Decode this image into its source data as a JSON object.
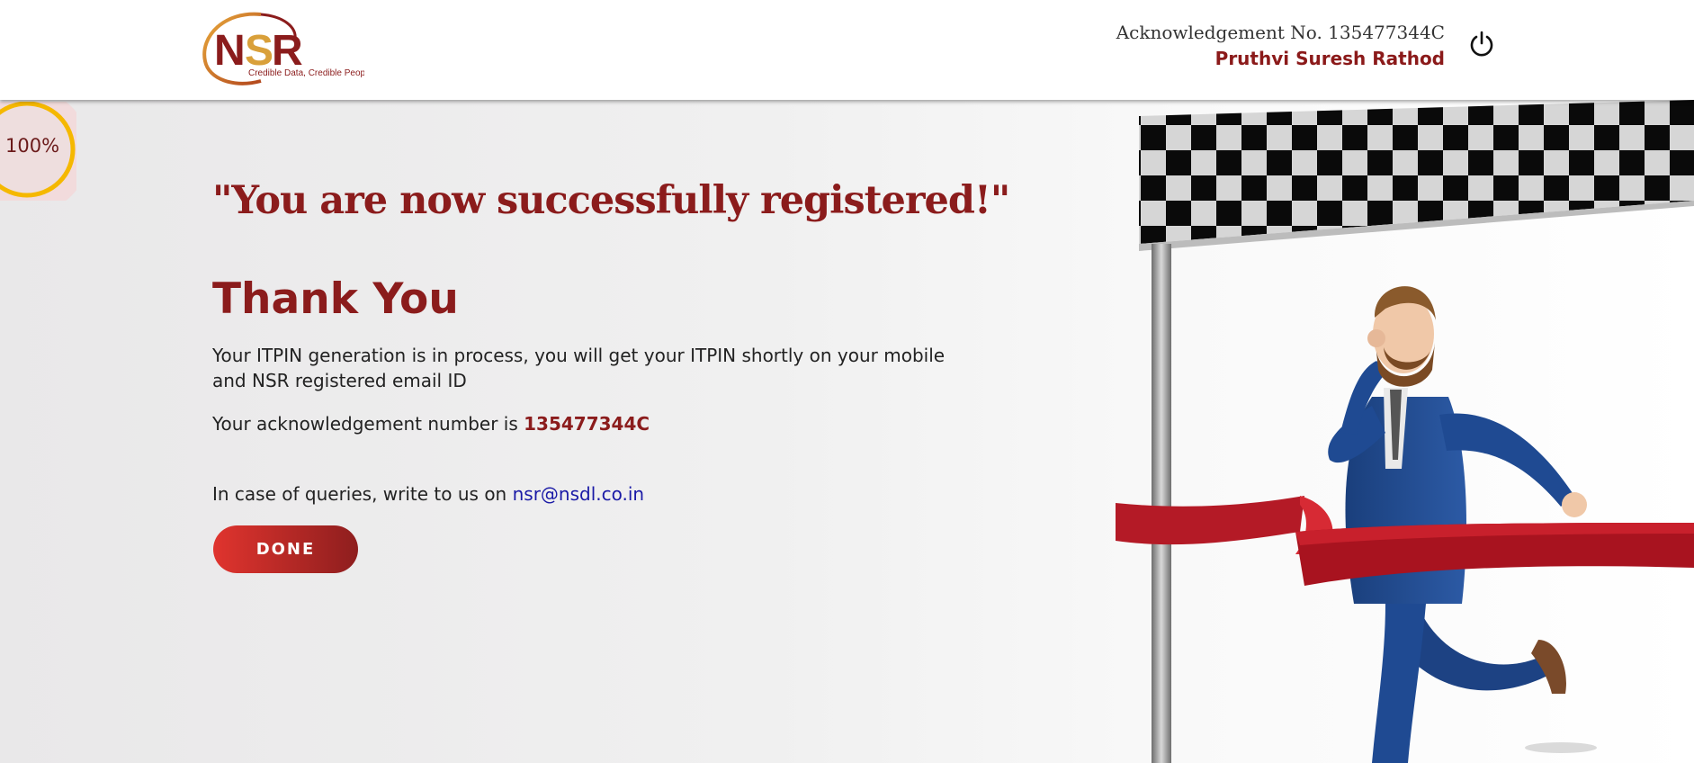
{
  "header": {
    "logo": {
      "brand": "NSR",
      "tagline": "Credible Data, Credible People"
    },
    "acknowledgement_label": "Acknowledgement No. 135477344C",
    "user_name": "Pruthvi Suresh Rathod",
    "power_icon": "power-icon"
  },
  "progress": {
    "label": "100%",
    "value": 1.0,
    "ring_color": "#f5b800"
  },
  "main": {
    "title": "\"You are now successfully registered!\"",
    "heading": "Thank You",
    "itpin_message": "Your ITPIN generation is in process, you will get your ITPIN shortly on your mobile and NSR registered email ID",
    "ack_prefix": "Your acknowledgement number is ",
    "ack_number": "135477344C",
    "query_prefix": "In case of queries, write to us on ",
    "query_email": "nsr@nsdl.co.in",
    "done_label": "DONE"
  },
  "colors": {
    "brand_red": "#8b1c1c",
    "button_start": "#e0342e",
    "button_end": "#8e1e1e",
    "link": "#1a1aa6"
  },
  "illustration": "finish-line-businessman"
}
